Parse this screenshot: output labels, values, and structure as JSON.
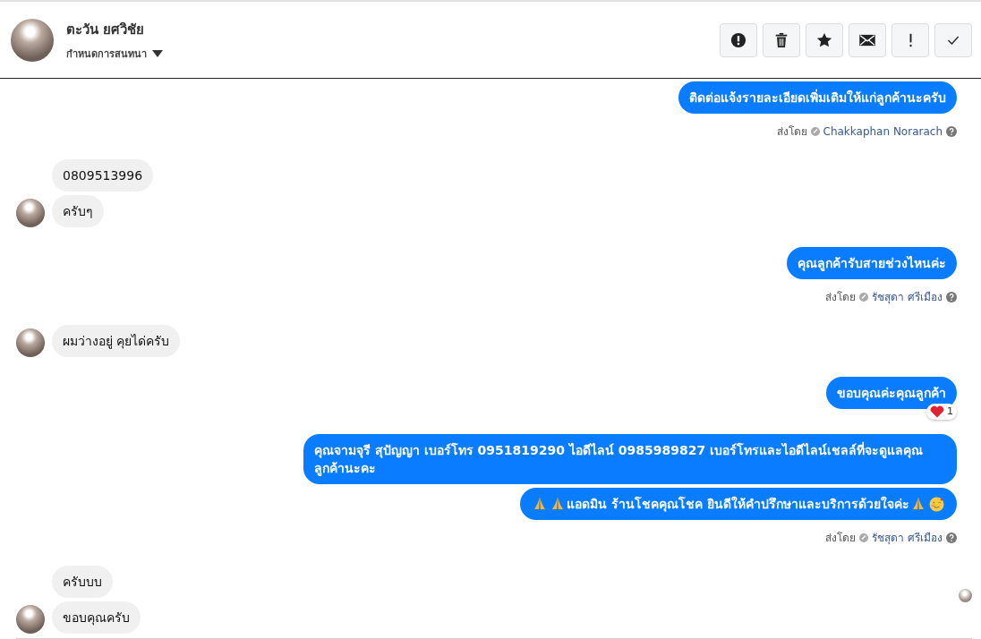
{
  "header": {
    "name": "ตะวัน ยศวิชัย",
    "subtitle": "กำหนดการสนทนา",
    "buttons": [
      {
        "kind": "alert"
      },
      {
        "kind": "trash"
      },
      {
        "kind": "star"
      },
      {
        "kind": "mail"
      },
      {
        "kind": "exclaim"
      },
      {
        "kind": "check"
      }
    ]
  },
  "messages": [
    {
      "kind": "outgoing",
      "bubbles": [
        {
          "parts": [
            {
              "kind": "text",
              "text": "ติดต่อแจ้งรายละเอียดเพิ่มเติมให้แก่ลูกค้านะครับ"
            }
          ]
        }
      ],
      "sent_label": "ส่งโดย",
      "sent_by": "Chakkaphan Norarach"
    },
    {
      "kind": "incoming",
      "bubbles": [
        {
          "parts": [
            {
              "kind": "text",
              "text": "0809513996"
            }
          ]
        },
        {
          "parts": [
            {
              "kind": "text",
              "text": "ครับๆ"
            }
          ]
        }
      ]
    },
    {
      "kind": "outgoing",
      "bubbles": [
        {
          "parts": [
            {
              "kind": "text",
              "text": "คุณลูกค้ารับสายช่วงไหนค่ะ"
            }
          ]
        }
      ],
      "sent_label": "ส่งโดย",
      "sent_by": "รัชสุดา ศรีเมือง"
    },
    {
      "kind": "incoming",
      "bubbles": [
        {
          "parts": [
            {
              "kind": "text",
              "text": "ผมว่างอยู่ คุยได่ครับ"
            }
          ]
        }
      ]
    },
    {
      "kind": "outgoing",
      "bubbles": [
        {
          "parts": [
            {
              "kind": "text",
              "text": "ขอบคุณค่ะคุณลูกค้า"
            }
          ],
          "reaction": "1"
        }
      ]
    },
    {
      "kind": "outgoing",
      "bubbles": [
        {
          "parts": [
            {
              "kind": "text",
              "text": "คุณจามจุรี สุปัญญา เบอร์โทร 0951819290  ไอดีไลน์ 0985989827   เบอร์โทรและไอดีไลน์เชลล์ที่จะดูแลคุณลูกค้านะคะ"
            }
          ]
        },
        {
          "parts": [
            {
              "kind": "pray"
            },
            {
              "kind": "pray"
            },
            {
              "kind": "text",
              "text": "แอดมิน ร้านโชคคุณโชค ยินดีให้คำปรึกษาและบริการด้วยใจค่ะ"
            },
            {
              "kind": "pray"
            },
            {
              "kind": "smile"
            }
          ]
        }
      ],
      "sent_label": "ส่งโดย",
      "sent_by": "รัชสุดา ศรีเมือง"
    },
    {
      "kind": "incoming",
      "read_receipt": true,
      "bubbles": [
        {
          "parts": [
            {
              "kind": "text",
              "text": "ครับบบ"
            }
          ]
        },
        {
          "parts": [
            {
              "kind": "text",
              "text": "ขอบคุณครับ"
            }
          ]
        }
      ]
    }
  ]
}
